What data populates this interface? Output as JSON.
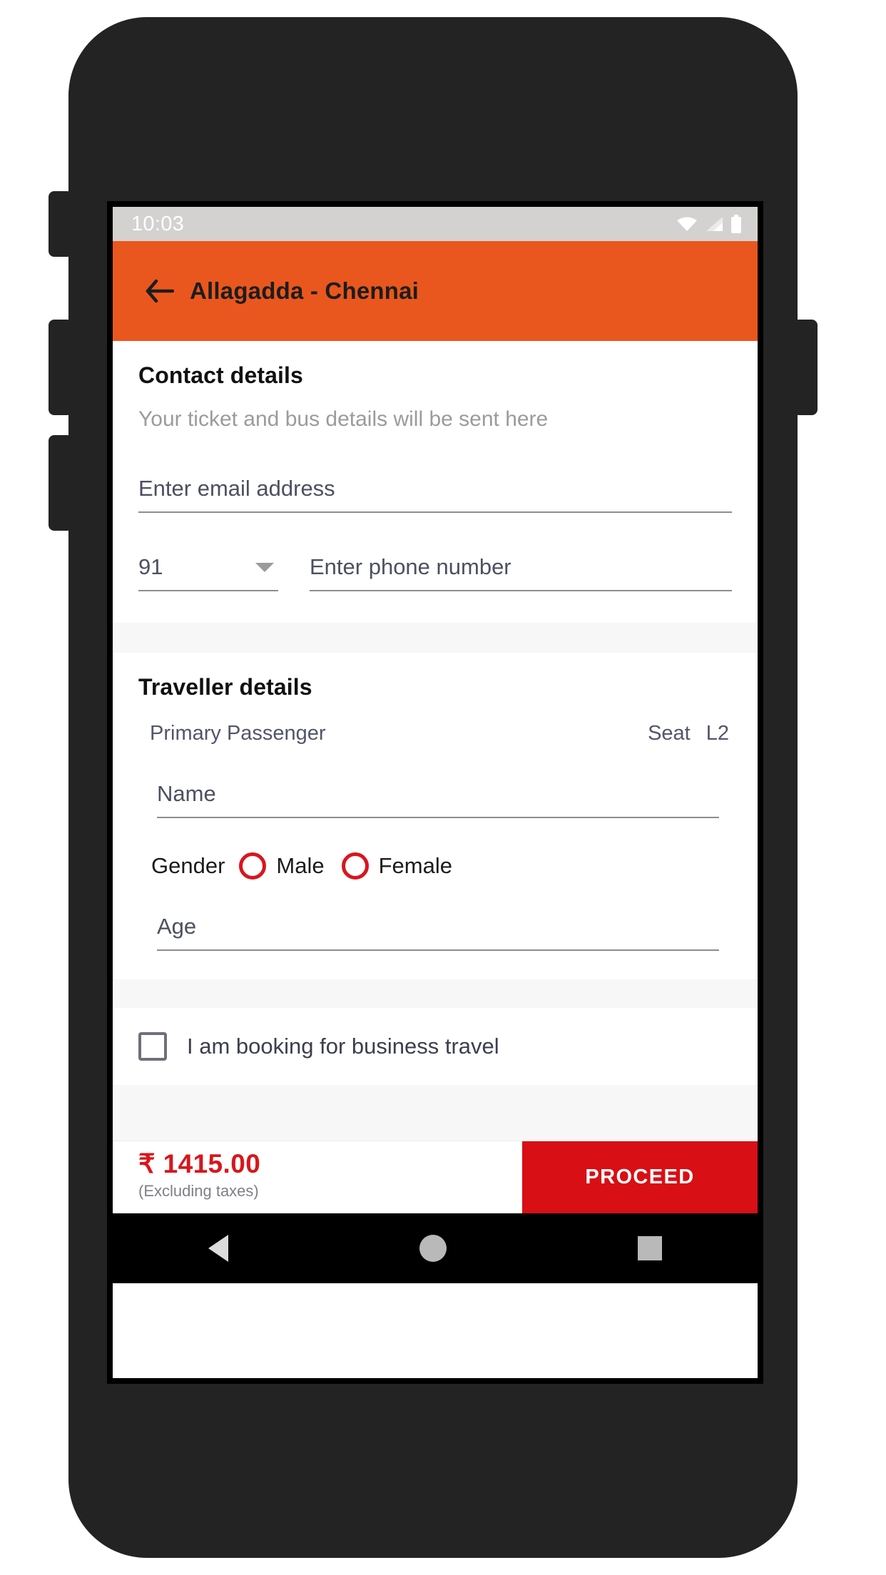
{
  "status_bar": {
    "time": "10:03",
    "icons": [
      "wifi-icon",
      "cellular-signal-icon",
      "battery-icon"
    ]
  },
  "app_bar": {
    "back_icon": "back-arrow-icon",
    "title": "Allagadda - Chennai",
    "background_color": "#e9571e"
  },
  "contact": {
    "title": "Contact details",
    "subtitle": "Your ticket and bus details will be sent here",
    "email_placeholder": "Enter email address",
    "email_value": "",
    "country_code": "91",
    "country_code_icon": "chevron-down-icon",
    "phone_placeholder": "Enter phone number",
    "phone_value": ""
  },
  "traveller": {
    "title": "Traveller details",
    "passenger_label": "Primary Passenger",
    "seat_label": "Seat",
    "seat_value": "L2",
    "name_placeholder": "Name",
    "name_value": "",
    "gender_label": "Gender",
    "gender_options": [
      {
        "label": "Male",
        "selected": false
      },
      {
        "label": "Female",
        "selected": false
      }
    ],
    "age_placeholder": "Age",
    "age_value": ""
  },
  "business": {
    "label": "I am booking for business travel",
    "checked": false
  },
  "footer": {
    "price": "₹ 1415.00",
    "price_note": "(Excluding taxes)",
    "price_color": "#d8161c",
    "proceed_label": "PROCEED",
    "proceed_color": "#d80f14"
  },
  "nav_bar": {
    "items": [
      "back-triangle-icon",
      "home-circle-icon",
      "recents-square-icon"
    ]
  }
}
